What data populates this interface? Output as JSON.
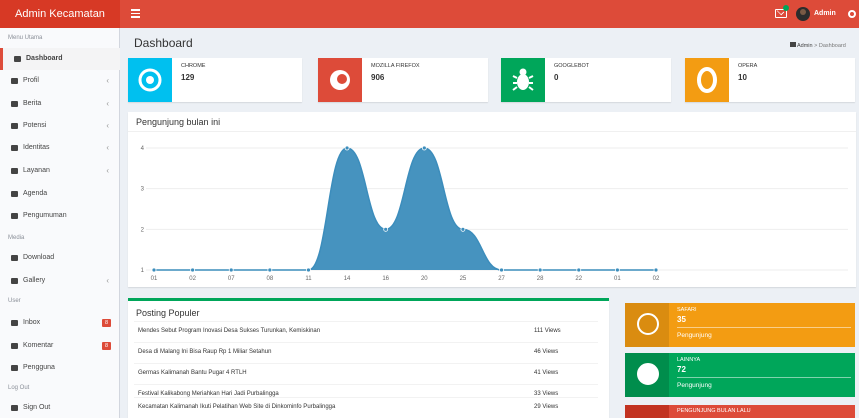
{
  "header": {
    "app_title": "Admin Kecamatan",
    "user_name": "Admin"
  },
  "sidebar": {
    "heading_main": "Menu Utama",
    "heading_media": "Media",
    "heading_user": "User",
    "heading_logout": "Log Out",
    "items": [
      {
        "label": "Dashboard",
        "icon": "dashboard-icon"
      },
      {
        "label": "Profil",
        "icon": "gear-icon"
      },
      {
        "label": "Berita",
        "icon": "newspaper-icon"
      },
      {
        "label": "Potensi",
        "icon": "hammer-icon"
      },
      {
        "label": "Identitas",
        "icon": "sitemap-icon"
      },
      {
        "label": "Layanan",
        "icon": "list-icon"
      },
      {
        "label": "Agenda",
        "icon": "calendar-icon"
      },
      {
        "label": "Pengumuman",
        "icon": "bullhorn-icon"
      },
      {
        "label": "Download",
        "icon": "download-icon"
      },
      {
        "label": "Gallery",
        "icon": "camera-icon"
      },
      {
        "label": "Inbox",
        "icon": "envelope-icon",
        "badge": "8"
      },
      {
        "label": "Komentar",
        "icon": "comments-icon",
        "badge": "8"
      },
      {
        "label": "Pengguna",
        "icon": "users-icon"
      },
      {
        "label": "Sign Out",
        "icon": "sign-out-icon"
      }
    ]
  },
  "page": {
    "title": "Dashboard",
    "breadcrumb": {
      "home": "Admin",
      "separator": ">",
      "current": "Dashboard"
    }
  },
  "browser_stats": [
    {
      "label": "CHROME",
      "value": "129",
      "color": "#00c0ef",
      "icon": "chrome-icon"
    },
    {
      "label": "MOZILLA FIREFOX",
      "value": "906",
      "color": "#dd4b39",
      "icon": "firefox-icon"
    },
    {
      "label": "GOOGLEBOT",
      "value": "0",
      "color": "#00a65a",
      "icon": "bug-icon"
    },
    {
      "label": "OPERA",
      "value": "10",
      "color": "#f39c12",
      "icon": "opera-icon"
    }
  ],
  "visitors_panel": {
    "title": "Pengunjung bulan ini"
  },
  "chart_data": {
    "type": "area",
    "title": "",
    "x": [
      "01",
      "02",
      "07",
      "08",
      "11",
      "14",
      "16",
      "20",
      "25",
      "27",
      "28",
      "22",
      "01",
      "02"
    ],
    "values": [
      1,
      1,
      1,
      1,
      1,
      4,
      2,
      4,
      2,
      1,
      1,
      1,
      1,
      1
    ],
    "ylim": [
      1,
      4
    ],
    "yticks": [
      1,
      2,
      3,
      4
    ],
    "grid": true,
    "color": "#3c8dbc"
  },
  "popular_posts": {
    "title": "Posting Populer",
    "rows": [
      {
        "title": "Mendes Sebut Program Inovasi Desa Sukses Turunkan, Kemiskinan",
        "views": "111 Views"
      },
      {
        "title": "Desa di Malang Ini Bisa Raup Rp 1 Miliar Setahun",
        "views": "46 Views"
      },
      {
        "title": "Germas Kalimanah Bantu Pugar 4 RTLH",
        "views": "41 Views"
      },
      {
        "title": "Festival Kalikabong Meriahkan Hari Jadi Purbalingga",
        "views": "33 Views"
      },
      {
        "title": "Kecamatan Kalimanah Ikuti Pelatihan Web Site di Dinkominfo Purbalingga",
        "views": "29 Views"
      }
    ]
  },
  "side_stats": [
    {
      "label": "SAFARI",
      "value": "35",
      "footer": "Pengunjung",
      "color": "#f39c12",
      "dark": "#da8c10",
      "icon": "compass-icon"
    },
    {
      "label": "LAINNYA",
      "value": "72",
      "footer": "Pengunjung",
      "color": "#00a65a",
      "dark": "#008d4c",
      "icon": "globe-icon"
    },
    {
      "label": "PENGUNJUNG BULAN LALU",
      "color": "#dd4b39",
      "dark": "#c23321"
    }
  ]
}
